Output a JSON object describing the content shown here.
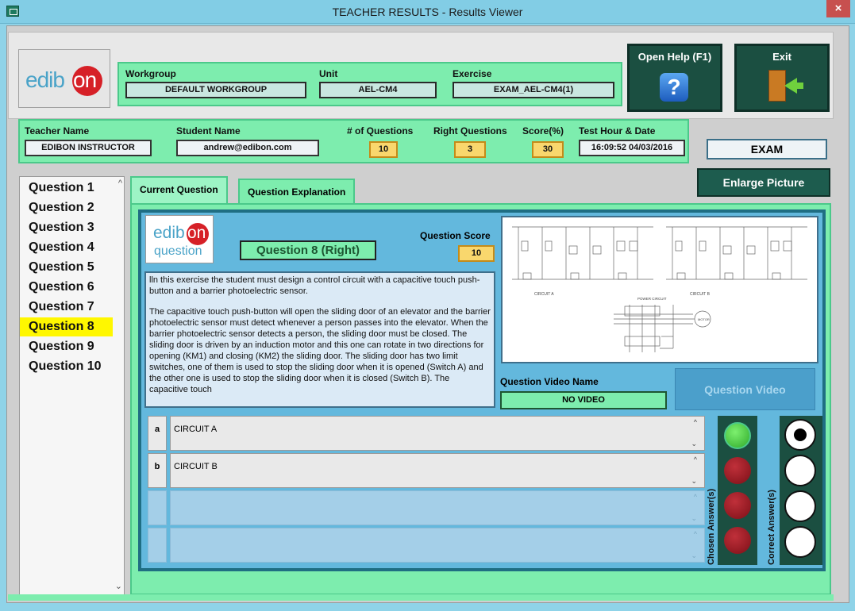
{
  "window": {
    "title": "TEACHER RESULTS - Results Viewer",
    "close_glyph": "×"
  },
  "logo": {
    "text_pre": "edib",
    "text_on": "on"
  },
  "workgroup": {
    "label": "Workgroup",
    "value": "DEFAULT WORKGROUP"
  },
  "unit": {
    "label": "Unit",
    "value": "AEL-CM4"
  },
  "exercise": {
    "label": "Exercise",
    "value": "EXAM_AEL-CM4(1)"
  },
  "help": {
    "label": "Open Help (F1)",
    "glyph": "?"
  },
  "exit": {
    "label": "Exit"
  },
  "teacher": {
    "label": "Teacher Name",
    "value": "EDIBON INSTRUCTOR"
  },
  "student": {
    "label": "Student Name",
    "value": "andrew@edibon.com"
  },
  "num_questions": {
    "label": "# of Questions",
    "value": "10"
  },
  "right_questions": {
    "label": "Right Questions",
    "value": "3"
  },
  "score": {
    "label": "Score(%)",
    "value": "30"
  },
  "test_date": {
    "label": "Test Hour & Date",
    "value": "16:09:52 04/03/2016"
  },
  "mode": "EXAM",
  "enlarge_label": "Enlarge Picture",
  "questions": [
    "Question 1",
    "Question 2",
    "Question 3",
    "Question 4",
    "Question 5",
    "Question 6",
    "Question 7",
    "Question 8",
    "Question 9",
    "Question 10"
  ],
  "selected_question": 8,
  "tabs": {
    "current": "Current Question",
    "explanation": "Question Explanation"
  },
  "qlogo": {
    "text_pre": "edib",
    "text_on": "on",
    "sub": "question"
  },
  "question_title": "Question 8 (Right)",
  "question_score": {
    "label": "Question Score",
    "value": "10"
  },
  "description": [
    "lln this exercise the student must design a control circuit with a capacitive touch push-button and a barrier photoelectric sensor.",
    "The capacitive touch push-button will open the sliding door of an elevator and the barrier photoelectric sensor must detect whenever a person passes into the elevator. When the barrier photoelectric sensor detects a person, the sliding door must be closed. The sliding door is driven by an induction motor and this one can rotate in two directions for opening (KM1) and closing (KM2) the sliding door. The sliding door has two limit switches, one of them is used to stop the sliding door when it is opened (Switch A) and the other one is used to stop the sliding door when it is closed (Switch B). The capacitive touch"
  ],
  "diagram": {
    "label_a": "CIRCUIT A",
    "label_b": "CIRCUIT B",
    "label_power": "POWER CIRCUIT",
    "label_motor": "MOTOR"
  },
  "video": {
    "label": "Question Video Name",
    "value": "NO VIDEO",
    "button": "Question Video"
  },
  "answers": [
    {
      "letter": "a",
      "text": "CIRCUIT A"
    },
    {
      "letter": "b",
      "text": "CIRCUIT B"
    },
    {
      "letter": "",
      "text": ""
    },
    {
      "letter": "",
      "text": ""
    }
  ],
  "chosen_label": "Chosen Answer(s)",
  "correct_label": "Correct Answer(s)",
  "chosen_states": [
    "green",
    "red",
    "red",
    "red"
  ],
  "correct_states": [
    true,
    false,
    false,
    false
  ],
  "colors": {
    "accent_green": "#7dedae",
    "dark_teal": "#1b4f41",
    "highlight_yellow": "#fff700",
    "brand_red": "#d62027"
  }
}
